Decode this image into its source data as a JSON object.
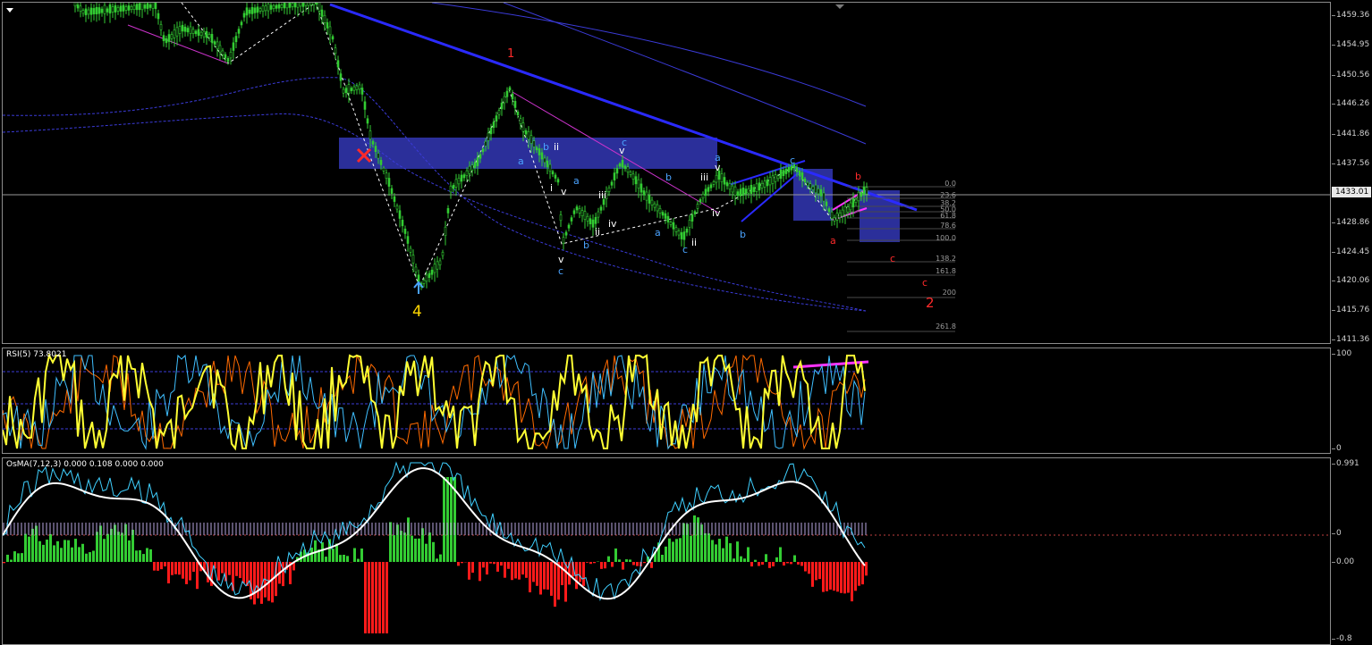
{
  "main": {
    "price_scale": [
      "1459.36",
      "1454.95",
      "1450.56",
      "1446.26",
      "1441.86",
      "1437.56",
      "1433.01",
      "1428.86",
      "1424.45",
      "1420.06",
      "1415.76",
      "1411.36"
    ],
    "current_price": "1433.01",
    "fib_levels": [
      "0.0",
      "23.6",
      "38.2",
      "50.0",
      "61.8",
      "78.6",
      "100.0",
      "138.2",
      "161.8",
      "200",
      "261.8"
    ],
    "wave_labels": {
      "red_1": "1",
      "yellow_4": "4",
      "red_2": "2",
      "a1": "a",
      "b1": "b",
      "ii1": "ii",
      "i1": "i",
      "v1": "v",
      "a2": "a",
      "b2": "b",
      "iii1": "iii",
      "iv1": "iv",
      "v2": "v",
      "c1": "c",
      "v3": "v",
      "c2": "c",
      "ii2": "ii",
      "b3": "b",
      "a3": "a",
      "c3": "c",
      "ii3": "ii",
      "iii2": "iii",
      "a4": "a",
      "v4": "v",
      "iv2": "iv",
      "b4": "b",
      "c4": "c",
      "b5": "b",
      "a5": "a",
      "c5": "c",
      "c6": "c"
    },
    "colors": {
      "channel": "#2a2aff",
      "zone": "#2b2f9a",
      "rsi": "#ffff33",
      "osma_pos": "#33cc33",
      "osma_neg": "#ff1a1a",
      "wave_blue": "#4aa3ff",
      "wave_red": "#ff2a2a",
      "wave_yellow": "#ffd700"
    }
  },
  "rsi": {
    "label": "RSI(5) 73.8021",
    "scale": [
      "100",
      "0"
    ]
  },
  "osma": {
    "label": "OsMA(7,12,3) 0.000 0.108 0.000 0.000",
    "scale": [
      "0.991",
      "0",
      "0.00",
      "-0.8"
    ]
  }
}
